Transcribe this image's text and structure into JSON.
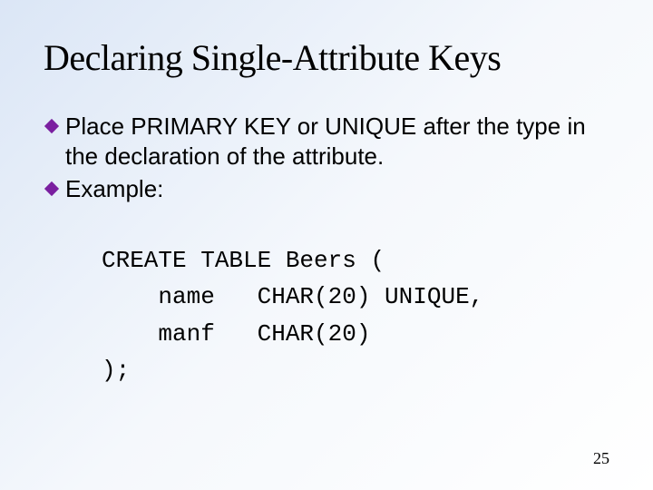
{
  "title": "Declaring Single-Attribute Keys",
  "bullets": [
    {
      "text": "Place PRIMARY KEY or UNIQUE after the type in the declaration of the attribute."
    },
    {
      "text": "Example:"
    }
  ],
  "code_lines": [
    "CREATE TABLE Beers (",
    "    name   CHAR(20) UNIQUE,",
    "    manf   CHAR(20)",
    ");"
  ],
  "page_number": "25",
  "colors": {
    "bullet": "#7a1fa0"
  }
}
